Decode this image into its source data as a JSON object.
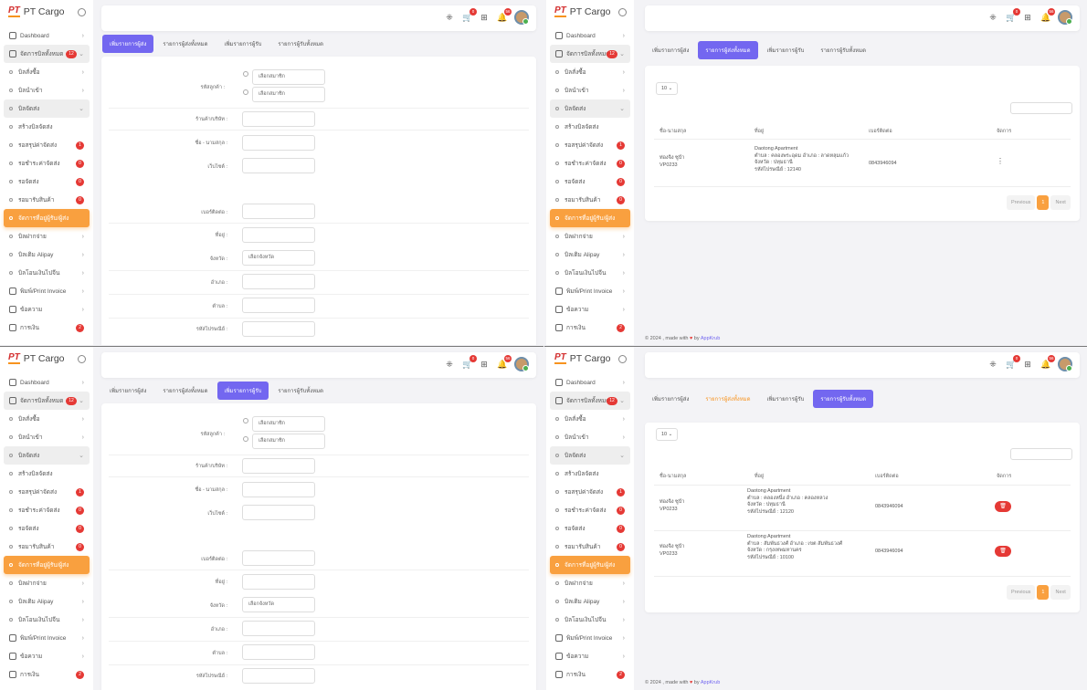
{
  "app": {
    "logo_mark": "PT",
    "logo_text": "PT Cargo"
  },
  "menu": [
    {
      "label": "Dashboard",
      "icon": "dashboard-icon",
      "kind": "top",
      "chev": true
    },
    {
      "label": "จัดการบิลทั้งหมด",
      "icon": "receipt-icon",
      "kind": "top-open",
      "badge": "12"
    },
    {
      "label": "บิลสั่งซื้อ",
      "kind": "sub",
      "chev": true
    },
    {
      "label": "บิลนำเข้า",
      "kind": "sub",
      "chev": true
    },
    {
      "label": "บิลจัดส่ง",
      "kind": "sub-open",
      "chev": true
    },
    {
      "label": "สร้างบิลจัดส่ง",
      "kind": "sub"
    },
    {
      "label": "รอสรุปค่าจัดส่ง",
      "kind": "sub",
      "badge": "1"
    },
    {
      "label": "รอชำระค่าจัดส่ง",
      "kind": "sub",
      "badge": "0"
    },
    {
      "label": "รอจัดส่ง",
      "kind": "sub",
      "badge": "0"
    },
    {
      "label": "รอมารับสินค้า",
      "kind": "sub",
      "badge": "0"
    },
    {
      "label": "จัดการที่อยู่ผู้รับ/ผู้ส่ง",
      "kind": "active"
    },
    {
      "label": "บิลฝากจ่าย",
      "kind": "sub",
      "chev": true
    },
    {
      "label": "บิลเติม Alipay",
      "kind": "sub",
      "chev": true
    },
    {
      "label": "บิลโอนเงินไปจีน",
      "kind": "sub",
      "chev": true
    },
    {
      "label": "พิมพ์/Print Invoice",
      "icon": "printer-icon",
      "kind": "top",
      "chev": true
    },
    {
      "label": "ข้อความ",
      "icon": "message-icon",
      "kind": "top",
      "chev": true
    },
    {
      "label": "การเงิน",
      "icon": "wallet-icon",
      "kind": "top",
      "badge": "2"
    }
  ],
  "navbar": {
    "icons": [
      {
        "name": "expand-icon",
        "glyph": "⁜",
        "badge": ""
      },
      {
        "name": "cart-icon",
        "glyph": "🛒",
        "badge": "0"
      },
      {
        "name": "apps-icon",
        "glyph": "⊞",
        "badge": ""
      },
      {
        "name": "bell-icon",
        "glyph": "🔔",
        "badge": "56"
      }
    ]
  },
  "tabs": [
    "เพิ่มรายการผู้ส่ง",
    "รายการผู้ส่งทั้งหมด",
    "เพิ่มรายการผู้รับ",
    "รายการผู้รับทั้งหมด"
  ],
  "form": {
    "code_label": "รหัสลูกค้า :",
    "member_option1": "เลือกสมาชิก",
    "member_option2": "เลือกสมาชิก",
    "shop_label": "ร้านค้า/บริษัท :",
    "name_label": "ชื่อ - นามสกุล :",
    "website_label": "เว็บไซต์ :",
    "phone_label": "เบอร์ติดต่อ :",
    "address_label": "ที่อยู่ :",
    "province_label": "จังหวัด :",
    "province_value": "เลือกจังหวัด",
    "district_label": "อำเภอ :",
    "subdistrict_label": "ตำบล :",
    "zip_label": "รหัสไปรษณีย์ :"
  },
  "table": {
    "page_size": "10",
    "headers": [
      "ชื่อ-นามสกุล",
      "ที่อยู่",
      "เบอร์ติดต่อ",
      "จัดการ"
    ],
    "sender_rows": [
      {
        "name1": "ท่องจิง ซูป้า",
        "name2": "VP0233",
        "addr1": "Daotong Apartment",
        "addr2": "ตำบล : คลองพระอุดม อำเภอ : ลาดหลุมแก้ว",
        "addr3": "จังหวัด : ปทุมธานี",
        "addr4": "รหัสไปรษณีย์ : 12140",
        "phone": "0843946094"
      }
    ],
    "receiver_rows": [
      {
        "name1": "ท่องจิง ซูป้า",
        "name2": "VP0233",
        "addr1": "Daotong Apartment",
        "addr2": "ตำบล : คลองหนึ่ง อำเภอ : คลองหลวง",
        "addr3": "จังหวัด : ปทุมธานี",
        "addr4": "รหัสไปรษณีย์ : 12120",
        "phone": "0843946094"
      },
      {
        "name1": "ท่องจิง ซูป้า",
        "name2": "VP0233",
        "addr1": "Daotong Apartment",
        "addr2": "ตำบล : สัมพันธวงศ์ อำเภอ : เขต สัมพันธวงศ์",
        "addr3": "จังหวัด : กรุงเทพมหานคร",
        "addr4": "รหัสไปรษณีย์ : 10100",
        "phone": "0843946094"
      }
    ],
    "prev": "Previous",
    "page": "1",
    "next": "Next"
  },
  "footer": {
    "prefix": "© 2024 , made with",
    "by": "by",
    "link": "AppKrub"
  },
  "colors": {
    "accent": "#7367f0",
    "active": "#f9a03f",
    "danger": "#e53935"
  }
}
